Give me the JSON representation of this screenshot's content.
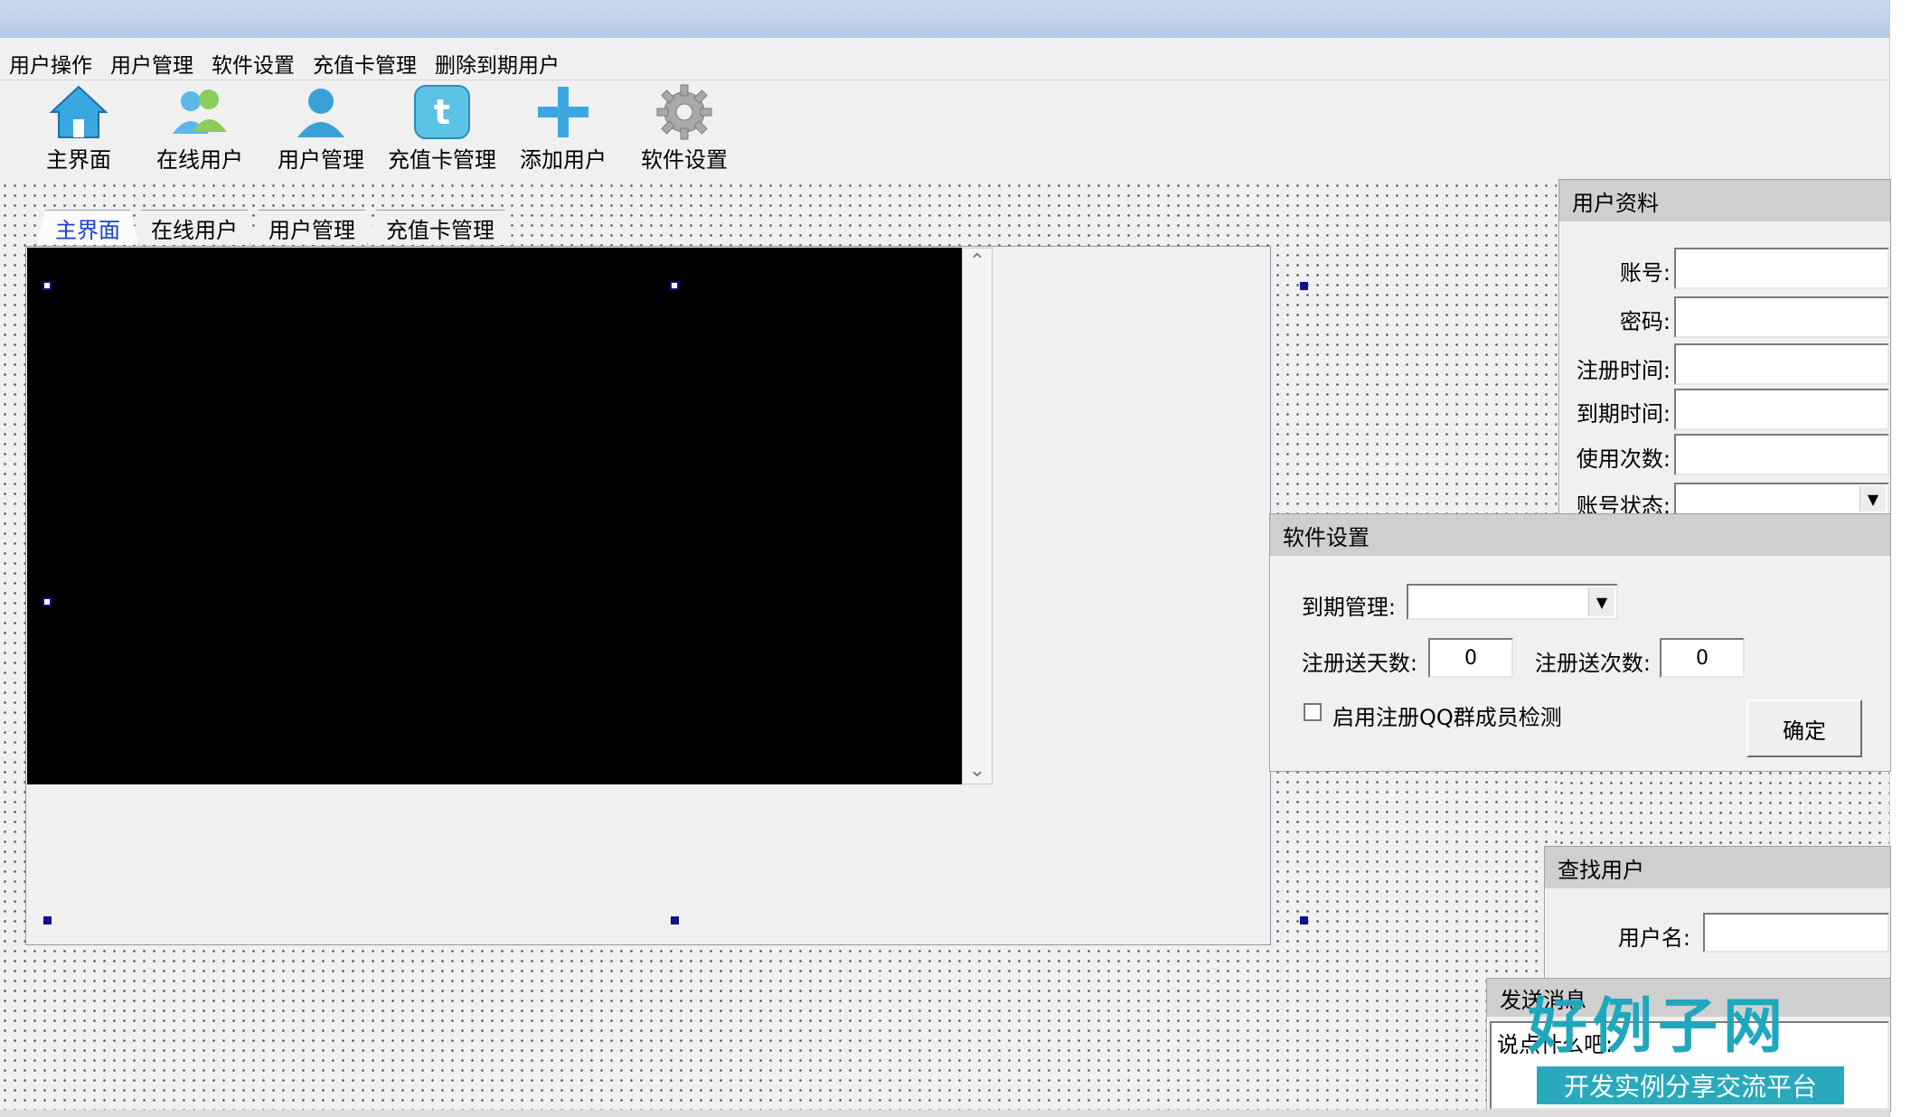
{
  "menu": [
    "用户操作",
    "用户管理",
    "软件设置",
    "充值卡管理",
    "删除到期用户"
  ],
  "toolbar": [
    {
      "label": "主界面",
      "icon": "home-icon"
    },
    {
      "label": "在线用户",
      "icon": "users-online-icon"
    },
    {
      "label": "用户管理",
      "icon": "user-icon"
    },
    {
      "label": "充值卡管理",
      "icon": "card-icon"
    },
    {
      "label": "添加用户",
      "icon": "plus-icon"
    },
    {
      "label": "软件设置",
      "icon": "gear-icon"
    }
  ],
  "tabs": [
    "主界面",
    "在线用户",
    "用户管理",
    "充值卡管理"
  ],
  "user_info": {
    "title": "用户资料",
    "account_label": "账号:",
    "password_label": "密码:",
    "reg_time_label": "注册时间:",
    "expire_time_label": "到期时间:",
    "usage_count_label": "使用次数:",
    "status_label": "账号状态:"
  },
  "software_settings": {
    "title": "软件设置",
    "expire_mgmt_label": "到期管理:",
    "reg_days_label": "注册送天数:",
    "reg_days_value": "0",
    "reg_times_label": "注册送次数:",
    "reg_times_value": "0",
    "qq_check_label": "启用注册QQ群成员检测",
    "confirm_label": "确定"
  },
  "find_user": {
    "title": "查找用户",
    "username_label": "用户名:"
  },
  "send_message": {
    "title": "发送消息",
    "prompt": "说点什么吧:"
  },
  "watermark": {
    "brand": "好例子网",
    "tagline": "开发实例分享交流平台"
  },
  "colors": {
    "active_tab": "#1a3fd6",
    "group_header": "#cfcfcf",
    "handle": "#10108a",
    "watermark": "#1fa7bd"
  }
}
